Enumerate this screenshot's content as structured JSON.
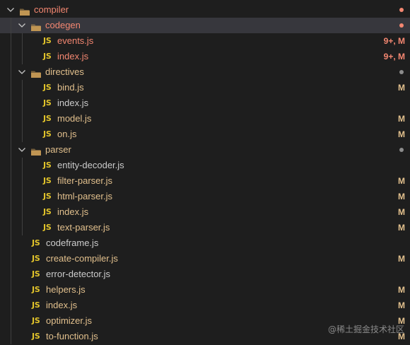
{
  "explorer": {
    "tree": [
      {
        "type": "folder",
        "name": "compiler",
        "depth": 0,
        "open": true,
        "status": "error",
        "decoration": "dot"
      },
      {
        "type": "folder",
        "name": "codegen",
        "depth": 1,
        "open": true,
        "status": "error",
        "decoration": "dot",
        "selected": true
      },
      {
        "type": "file",
        "name": "events.js",
        "depth": 2,
        "status": "error",
        "badge": "9+, M"
      },
      {
        "type": "file",
        "name": "index.js",
        "depth": 2,
        "status": "error",
        "badge": "9+, M"
      },
      {
        "type": "folder",
        "name": "directives",
        "depth": 1,
        "open": true,
        "status": "modified",
        "decoration": "dot"
      },
      {
        "type": "file",
        "name": "bind.js",
        "depth": 2,
        "status": "modified",
        "badge": "M"
      },
      {
        "type": "file",
        "name": "index.js",
        "depth": 2,
        "status": "plain",
        "badge": ""
      },
      {
        "type": "file",
        "name": "model.js",
        "depth": 2,
        "status": "modified",
        "badge": "M"
      },
      {
        "type": "file",
        "name": "on.js",
        "depth": 2,
        "status": "modified",
        "badge": "M"
      },
      {
        "type": "folder",
        "name": "parser",
        "depth": 1,
        "open": true,
        "status": "modified",
        "decoration": "dot"
      },
      {
        "type": "file",
        "name": "entity-decoder.js",
        "depth": 2,
        "status": "plain",
        "badge": ""
      },
      {
        "type": "file",
        "name": "filter-parser.js",
        "depth": 2,
        "status": "modified",
        "badge": "M"
      },
      {
        "type": "file",
        "name": "html-parser.js",
        "depth": 2,
        "status": "modified",
        "badge": "M"
      },
      {
        "type": "file",
        "name": "index.js",
        "depth": 2,
        "status": "modified",
        "badge": "M"
      },
      {
        "type": "file",
        "name": "text-parser.js",
        "depth": 2,
        "status": "modified",
        "badge": "M"
      },
      {
        "type": "file",
        "name": "codeframe.js",
        "depth": 1,
        "status": "plain",
        "badge": ""
      },
      {
        "type": "file",
        "name": "create-compiler.js",
        "depth": 1,
        "status": "modified",
        "badge": "M"
      },
      {
        "type": "file",
        "name": "error-detector.js",
        "depth": 1,
        "status": "plain",
        "badge": ""
      },
      {
        "type": "file",
        "name": "helpers.js",
        "depth": 1,
        "status": "modified",
        "badge": "M"
      },
      {
        "type": "file",
        "name": "index.js",
        "depth": 1,
        "status": "modified",
        "badge": "M"
      },
      {
        "type": "file",
        "name": "optimizer.js",
        "depth": 1,
        "status": "modified",
        "badge": "M"
      },
      {
        "type": "file",
        "name": "to-function.js",
        "depth": 1,
        "status": "modified",
        "badge": "M"
      }
    ],
    "js_icon_text": "JS",
    "watermark": "@稀土掘金技术社区"
  },
  "colors": {
    "background": "#1e1e1e",
    "selected": "#37373d",
    "modified": "#e2c08d",
    "error": "#f48771",
    "plain": "#cccccc",
    "js_icon": "#e2c42b",
    "folder": "#c09553",
    "dot_modified": "#8c8c8c",
    "dot_error": "#f48771"
  }
}
